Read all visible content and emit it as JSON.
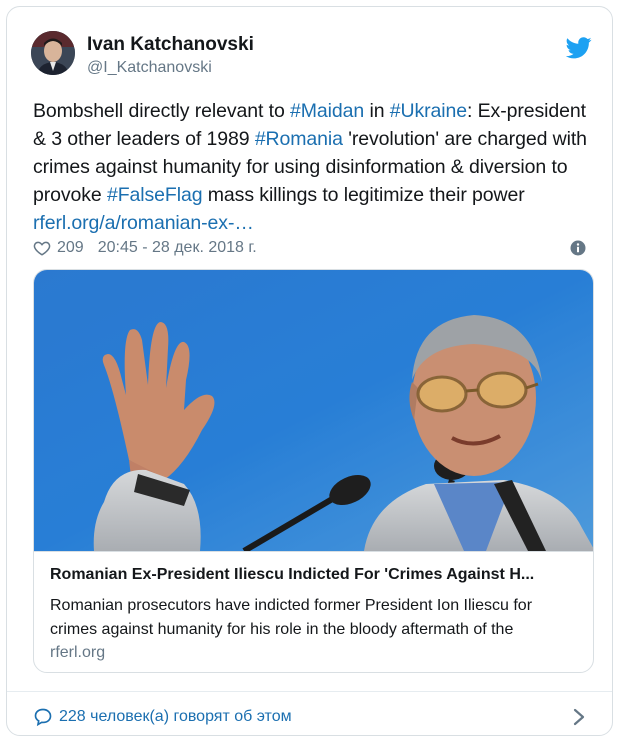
{
  "author": {
    "name": "Ivan Katchanovski",
    "handle": "@I_Katchanovski"
  },
  "tweet": {
    "segments": [
      {
        "text": "Bombshell directly relevant to ",
        "link": false
      },
      {
        "text": "#Maidan",
        "link": true
      },
      {
        "text": " in ",
        "link": false
      },
      {
        "text": "#Ukraine",
        "link": true
      },
      {
        "text": ": Ex-president & 3 other leaders of 1989 ",
        "link": false
      },
      {
        "text": "#Romania",
        "link": true
      },
      {
        "text": " 'revolution' are charged with crimes against humanity for using disinformation & diversion to provoke ",
        "link": false
      },
      {
        "text": "#FalseFlag",
        "link": true
      },
      {
        "text": " mass killings to legitimize their power ",
        "link": false
      },
      {
        "text": "rferl.org/a/romanian-ex-…",
        "link": true
      }
    ]
  },
  "meta": {
    "likes": "209",
    "timestamp": "20:45 - 28 дек. 2018 г."
  },
  "link_card": {
    "title": "Romanian Ex-President Iliescu Indicted For 'Crimes Against H...",
    "description": "Romanian prosecutors have indicted former President Ion Iliescu for crimes against humanity for his role in the bloody aftermath of the",
    "domain": "rferl.org"
  },
  "footer": {
    "discussion": "228 человек(а) говорят об этом"
  },
  "icons": {
    "twitter": "twitter-bird-icon",
    "heart": "heart-icon",
    "info": "info-icon",
    "bubble": "speech-bubble-icon",
    "chevron": "chevron-right-icon"
  },
  "colors": {
    "link": "#1b6fb0",
    "twitter_blue": "#1da1f2",
    "muted": "#657786",
    "border": "#d9dfe3"
  }
}
